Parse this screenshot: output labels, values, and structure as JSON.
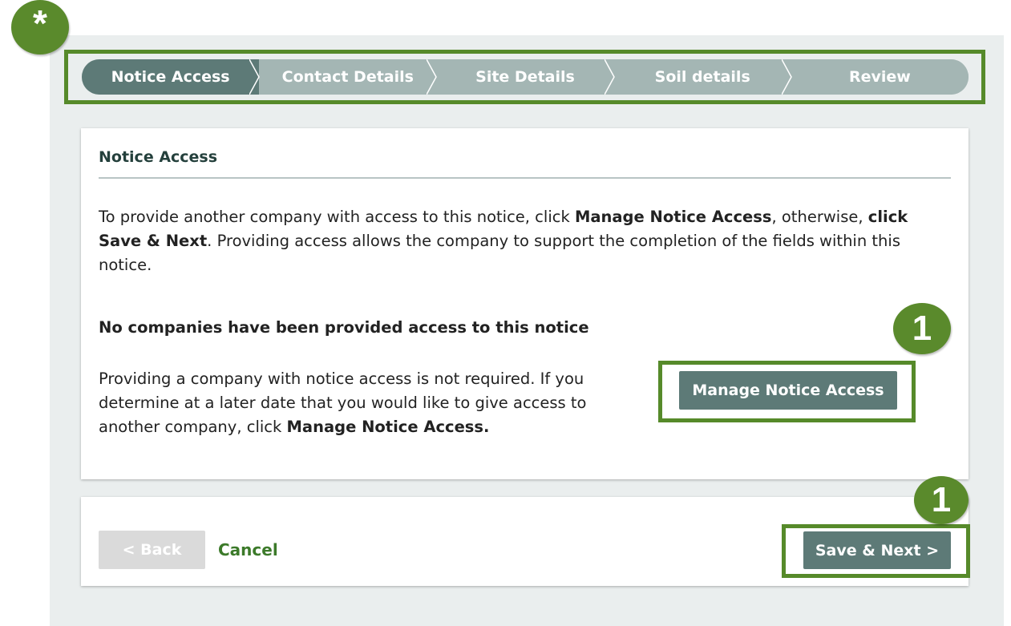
{
  "annotations": {
    "star": "*",
    "marker_manage": "1",
    "marker_save": "1"
  },
  "colors": {
    "annotation_green": "#5a8a2c",
    "step_active": "#5d7a77",
    "step_inactive": "#a4b6b4",
    "primary_button": "#5d7a77",
    "cancel_link": "#3c7a2a"
  },
  "stepper": {
    "steps": [
      {
        "label": "Notice Access",
        "state": "active"
      },
      {
        "label": "Contact Details",
        "state": "inactive"
      },
      {
        "label": "Site Details",
        "state": "inactive"
      },
      {
        "label": "Soil details",
        "state": "inactive"
      },
      {
        "label": "Review",
        "state": "inactive"
      }
    ]
  },
  "card": {
    "title": "Notice Access",
    "intro_part1": "To provide another company with access to this notice, click ",
    "intro_bold1": "Manage Notice Access",
    "intro_part2": ", otherwise, ",
    "intro_bold2": "click Save & Next",
    "intro_part3": ". Providing access allows the company to support the completion of the fields within this notice.",
    "no_access_heading": "No companies have been provided access to this notice",
    "optional_part1": "Providing a company with notice access is not required. If you determine at a later date that you would like to give access to another company, click ",
    "optional_bold": "Manage Notice Access.",
    "manage_button": "Manage Notice Access"
  },
  "footer": {
    "back_button": "< Back",
    "cancel_link": "Cancel",
    "save_next_button": "Save & Next >"
  }
}
